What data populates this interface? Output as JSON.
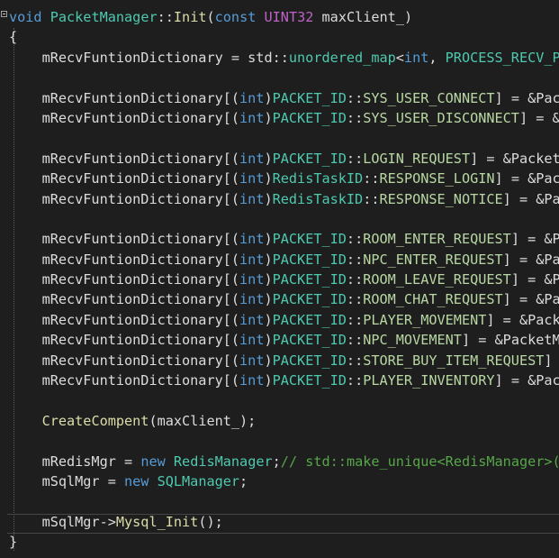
{
  "lines": [
    {
      "segments": [
        {
          "text": "void",
          "cls": "kw"
        },
        {
          "text": " ",
          "cls": "pl"
        },
        {
          "text": "PacketManager",
          "cls": "type"
        },
        {
          "text": "::",
          "cls": "pl"
        },
        {
          "text": "Init",
          "cls": "fn"
        },
        {
          "text": "(",
          "cls": "pl"
        },
        {
          "text": "const",
          "cls": "kw"
        },
        {
          "text": " ",
          "cls": "pl"
        },
        {
          "text": "UINT32",
          "cls": "mac"
        },
        {
          "text": " maxClient_)",
          "cls": "pl"
        }
      ]
    },
    {
      "segments": [
        {
          "text": "{",
          "cls": "pl"
        }
      ]
    },
    {
      "segments": [
        {
          "text": "    mRecvFuntionDictionary = std::",
          "cls": "pl"
        },
        {
          "text": "unordered_map",
          "cls": "type"
        },
        {
          "text": "<",
          "cls": "pl"
        },
        {
          "text": "int",
          "cls": "kw"
        },
        {
          "text": ", ",
          "cls": "pl"
        },
        {
          "text": "PROCESS_RECV_PACKET_FUNCTION",
          "cls": "type"
        },
        {
          "text": ">();",
          "cls": "pl"
        }
      ]
    },
    {
      "segments": []
    },
    {
      "segments": [
        {
          "text": "    mRecvFuntionDictionary[(",
          "cls": "pl"
        },
        {
          "text": "int",
          "cls": "kw"
        },
        {
          "text": ")",
          "cls": "pl"
        },
        {
          "text": "PACKET_ID",
          "cls": "type"
        },
        {
          "text": "::",
          "cls": "pl"
        },
        {
          "text": "SYS_USER_CONNECT",
          "cls": "enum"
        },
        {
          "text": "] = &PacketManager::ProcessUserConnect;",
          "cls": "pl"
        }
      ]
    },
    {
      "segments": [
        {
          "text": "    mRecvFuntionDictionary[(",
          "cls": "pl"
        },
        {
          "text": "int",
          "cls": "kw"
        },
        {
          "text": ")",
          "cls": "pl"
        },
        {
          "text": "PACKET_ID",
          "cls": "type"
        },
        {
          "text": "::",
          "cls": "pl"
        },
        {
          "text": "SYS_USER_DISCONNECT",
          "cls": "enum"
        },
        {
          "text": "] = &PacketManager::ProcessUserDisConnect;",
          "cls": "pl"
        }
      ]
    },
    {
      "segments": []
    },
    {
      "segments": [
        {
          "text": "    mRecvFuntionDictionary[(",
          "cls": "pl"
        },
        {
          "text": "int",
          "cls": "kw"
        },
        {
          "text": ")",
          "cls": "pl"
        },
        {
          "text": "PACKET_ID",
          "cls": "type"
        },
        {
          "text": "::",
          "cls": "pl"
        },
        {
          "text": "LOGIN_REQUEST",
          "cls": "enum"
        },
        {
          "text": "] = &PacketManager::ProcessLogin;",
          "cls": "pl"
        }
      ]
    },
    {
      "segments": [
        {
          "text": "    mRecvFuntionDictionary[(",
          "cls": "pl"
        },
        {
          "text": "int",
          "cls": "kw"
        },
        {
          "text": ")",
          "cls": "pl"
        },
        {
          "text": "RedisTaskID",
          "cls": "type"
        },
        {
          "text": "::",
          "cls": "pl"
        },
        {
          "text": "RESPONSE_LOGIN",
          "cls": "enum"
        },
        {
          "text": "] = &PacketManager::ProcessLoginDBResult;",
          "cls": "pl"
        }
      ]
    },
    {
      "segments": [
        {
          "text": "    mRecvFuntionDictionary[(",
          "cls": "pl"
        },
        {
          "text": "int",
          "cls": "kw"
        },
        {
          "text": ")",
          "cls": "pl"
        },
        {
          "text": "RedisTaskID",
          "cls": "type"
        },
        {
          "text": "::",
          "cls": "pl"
        },
        {
          "text": "RESPONSE_NOTICE",
          "cls": "enum"
        },
        {
          "text": "] = &PacketManager::ProcessNoticeDBResult;",
          "cls": "pl"
        }
      ]
    },
    {
      "segments": []
    },
    {
      "segments": [
        {
          "text": "    mRecvFuntionDictionary[(",
          "cls": "pl"
        },
        {
          "text": "int",
          "cls": "kw"
        },
        {
          "text": ")",
          "cls": "pl"
        },
        {
          "text": "PACKET_ID",
          "cls": "type"
        },
        {
          "text": "::",
          "cls": "pl"
        },
        {
          "text": "ROOM_ENTER_REQUEST",
          "cls": "enum"
        },
        {
          "text": "] = &PacketManager::ProcessEnterRoom;",
          "cls": "pl"
        }
      ]
    },
    {
      "segments": [
        {
          "text": "    mRecvFuntionDictionary[(",
          "cls": "pl"
        },
        {
          "text": "int",
          "cls": "kw"
        },
        {
          "text": ")",
          "cls": "pl"
        },
        {
          "text": "PACKET_ID",
          "cls": "type"
        },
        {
          "text": "::",
          "cls": "pl"
        },
        {
          "text": "NPC_ENTER_REQUEST",
          "cls": "enum"
        },
        {
          "text": "] = &PacketManager::ProcessNpcEnter;",
          "cls": "pl"
        }
      ]
    },
    {
      "segments": [
        {
          "text": "    mRecvFuntionDictionary[(",
          "cls": "pl"
        },
        {
          "text": "int",
          "cls": "kw"
        },
        {
          "text": ")",
          "cls": "pl"
        },
        {
          "text": "PACKET_ID",
          "cls": "type"
        },
        {
          "text": "::",
          "cls": "pl"
        },
        {
          "text": "ROOM_LEAVE_REQUEST",
          "cls": "enum"
        },
        {
          "text": "] = &PacketManager::ProcessLeaveRoom;",
          "cls": "pl"
        }
      ]
    },
    {
      "segments": [
        {
          "text": "    mRecvFuntionDictionary[(",
          "cls": "pl"
        },
        {
          "text": "int",
          "cls": "kw"
        },
        {
          "text": ")",
          "cls": "pl"
        },
        {
          "text": "PACKET_ID",
          "cls": "type"
        },
        {
          "text": "::",
          "cls": "pl"
        },
        {
          "text": "ROOM_CHAT_REQUEST",
          "cls": "enum"
        },
        {
          "text": "] = &PacketManager::ProcessRoomChatMessage;",
          "cls": "pl"
        }
      ]
    },
    {
      "segments": [
        {
          "text": "    mRecvFuntionDictionary[(",
          "cls": "pl"
        },
        {
          "text": "int",
          "cls": "kw"
        },
        {
          "text": ")",
          "cls": "pl"
        },
        {
          "text": "PACKET_ID",
          "cls": "type"
        },
        {
          "text": "::",
          "cls": "pl"
        },
        {
          "text": "PLAYER_MOVEMENT",
          "cls": "enum"
        },
        {
          "text": "] = &PacketManager::ProcessPlayerMovement;",
          "cls": "pl"
        }
      ]
    },
    {
      "segments": [
        {
          "text": "    mRecvFuntionDictionary[(",
          "cls": "pl"
        },
        {
          "text": "int",
          "cls": "kw"
        },
        {
          "text": ")",
          "cls": "pl"
        },
        {
          "text": "PACKET_ID",
          "cls": "type"
        },
        {
          "text": "::",
          "cls": "pl"
        },
        {
          "text": "NPC_MOVEMENT",
          "cls": "enum"
        },
        {
          "text": "] = &PacketManager::ProcessNpcMovement;",
          "cls": "pl"
        }
      ]
    },
    {
      "segments": [
        {
          "text": "    mRecvFuntionDictionary[(",
          "cls": "pl"
        },
        {
          "text": "int",
          "cls": "kw"
        },
        {
          "text": ")",
          "cls": "pl"
        },
        {
          "text": "PACKET_ID",
          "cls": "type"
        },
        {
          "text": "::",
          "cls": "pl"
        },
        {
          "text": "STORE_BUY_ITEM_REQUEST",
          "cls": "enum"
        },
        {
          "text": "] = &PacketManager::ProcessStoreBuyItem;",
          "cls": "pl"
        }
      ]
    },
    {
      "segments": [
        {
          "text": "    mRecvFuntionDictionary[(",
          "cls": "pl"
        },
        {
          "text": "int",
          "cls": "kw"
        },
        {
          "text": ")",
          "cls": "pl"
        },
        {
          "text": "PACKET_ID",
          "cls": "type"
        },
        {
          "text": "::",
          "cls": "pl"
        },
        {
          "text": "PLAYER_INVENTORY",
          "cls": "enum"
        },
        {
          "text": "] = &PacketManager::ProcessPlayerInventory;",
          "cls": "pl"
        }
      ]
    },
    {
      "segments": []
    },
    {
      "segments": [
        {
          "text": "    ",
          "cls": "pl"
        },
        {
          "text": "CreateCompent",
          "cls": "fn"
        },
        {
          "text": "(maxClient_);",
          "cls": "pl"
        }
      ]
    },
    {
      "segments": []
    },
    {
      "segments": [
        {
          "text": "    mRedisMgr = ",
          "cls": "pl"
        },
        {
          "text": "new",
          "cls": "kw"
        },
        {
          "text": " ",
          "cls": "pl"
        },
        {
          "text": "RedisManager",
          "cls": "type"
        },
        {
          "text": ";",
          "cls": "pl"
        },
        {
          "text": "// std::make_unique<RedisManager>();",
          "cls": "cm"
        }
      ]
    },
    {
      "segments": [
        {
          "text": "    mSqlMgr = ",
          "cls": "pl"
        },
        {
          "text": "new",
          "cls": "kw"
        },
        {
          "text": " ",
          "cls": "pl"
        },
        {
          "text": "SQLManager",
          "cls": "type"
        },
        {
          "text": ";",
          "cls": "pl"
        }
      ]
    },
    {
      "segments": []
    },
    {
      "segments": [
        {
          "text": "    mSqlMgr->",
          "cls": "pl"
        },
        {
          "text": "Mysql_Init",
          "cls": "fn"
        },
        {
          "text": "();",
          "cls": "pl"
        }
      ]
    },
    {
      "segments": [
        {
          "text": "}",
          "cls": "pl"
        }
      ]
    }
  ]
}
